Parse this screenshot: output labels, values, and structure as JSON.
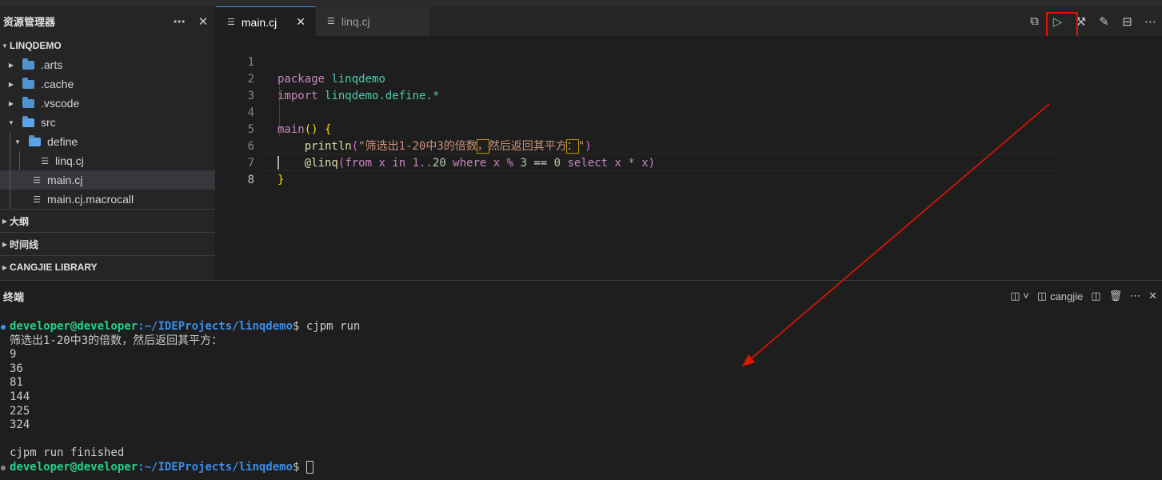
{
  "colors": {
    "accent": "#3794ff",
    "annotation": "#e51400",
    "run": "#89d185",
    "prompt_user": "#23d18b",
    "prompt_path": "#3b8eea"
  },
  "explorer": {
    "title": "资源管理器",
    "more_icon": "ellipsis-icon",
    "close_icon": "close-icon",
    "project": "LINQDEMO",
    "tree": [
      {
        "label": ".arts",
        "kind": "folder"
      },
      {
        "label": ".cache",
        "kind": "folder"
      },
      {
        "label": ".vscode",
        "kind": "folder"
      },
      {
        "label": "src",
        "kind": "folder-open"
      },
      {
        "label": "define",
        "kind": "folder-open"
      },
      {
        "label": "linq.cj",
        "kind": "file"
      },
      {
        "label": "main.cj",
        "kind": "file",
        "selected": true
      },
      {
        "label": "main.cj.macrocall",
        "kind": "file"
      }
    ],
    "sections": [
      "大纲",
      "时间线",
      "CANGJIE LIBRARY"
    ]
  },
  "tabs": [
    {
      "label": "main.cj",
      "active": true
    },
    {
      "label": "linq.cj",
      "active": false
    }
  ],
  "editor": {
    "line_numbers": [
      "1",
      "2",
      "3",
      "4",
      "5",
      "6",
      "7",
      "8"
    ],
    "line1": {
      "kw": "package",
      "name": "linqdemo"
    },
    "line2": {
      "kw": "import",
      "name": "linqdemo.define.*"
    },
    "line4": {
      "fn": "main",
      "open": "()",
      "brace": "{"
    },
    "line5": {
      "fn": "println",
      "p_open": "(",
      "str_a": "\"筛选出1-20中3的倍数",
      "str_b": "，",
      "str_c": "然后返回其平方",
      "str_d": "：",
      "str_e": "\"",
      "p_close": ")"
    },
    "line6": {
      "macro": "@linq",
      "p_open": "(",
      "body_a": "from x in 1..",
      "num20": "20",
      "body_b": " where x % ",
      "num3": "3",
      "body_c": " == ",
      "num0": "0",
      "body_d": " select x * x",
      "p_close": ")"
    },
    "line7": {
      "brace": "}"
    }
  },
  "terminal": {
    "title": "终端",
    "profile": "cangjie",
    "prompt_user": "developer@developer",
    "prompt_path": ":~/IDEProjects/linqdemo",
    "command": "$ cjpm run",
    "output": [
      "筛选出1-20中3的倍数，然后返回其平方：",
      "9",
      "36",
      "81",
      "144",
      "225",
      "324",
      "",
      "cjpm run finished"
    ],
    "prompt_end": "$ "
  }
}
